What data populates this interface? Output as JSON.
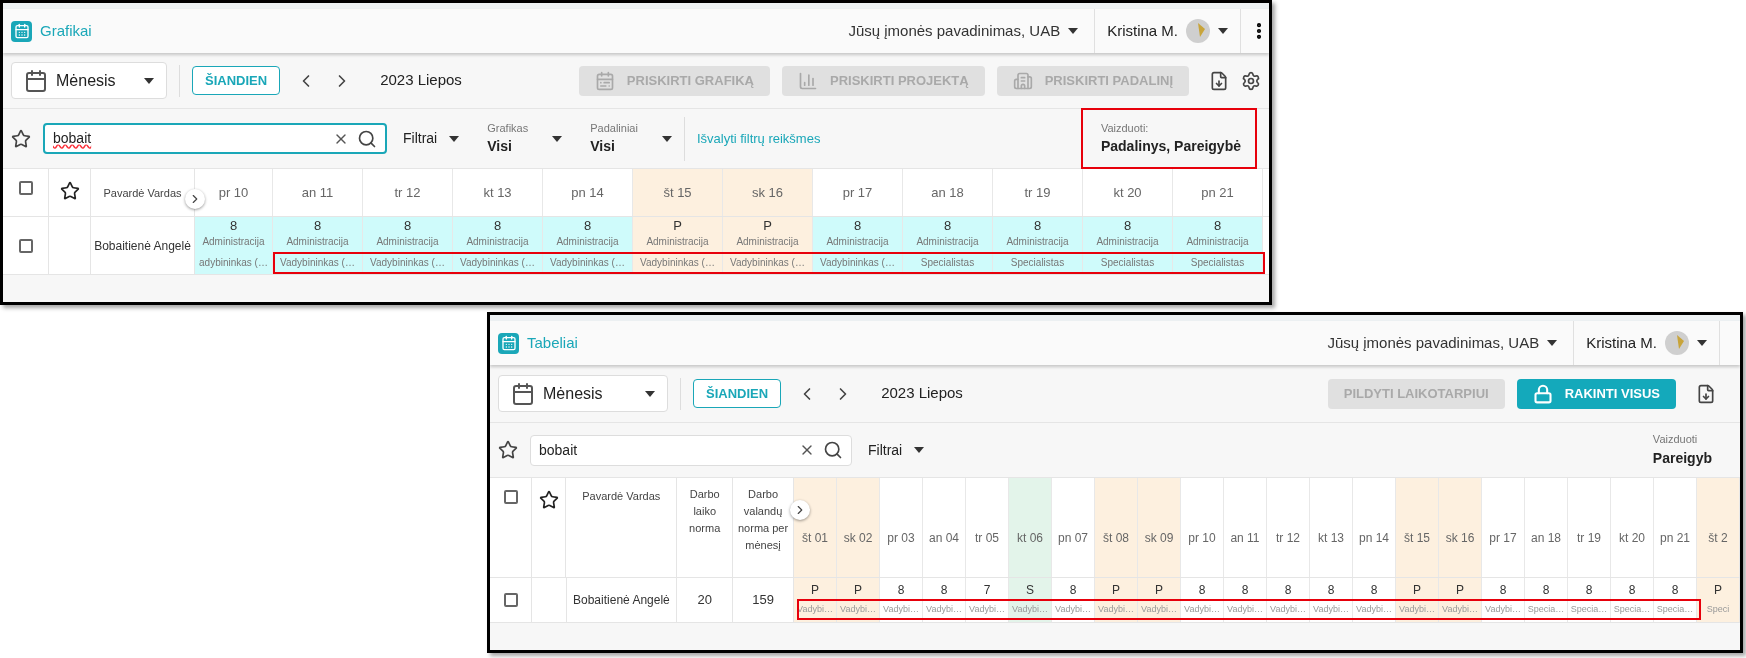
{
  "screens": [
    {
      "title": "Grafikai",
      "company": "Jūsų įmonės pavadinimas, UAB",
      "user": "Kristina M.",
      "more_menu": true,
      "view": "Mėnesis",
      "today_button": "ŠIANDIEN",
      "period": "2023 Liepos",
      "actions": [
        {
          "label": "PRISKIRTI GRAFIKĄ",
          "disabled": true
        },
        {
          "label": "PRISKIRTI PROJEKTĄ",
          "disabled": true
        },
        {
          "label": "PRISKIRTI PADALINĮ",
          "disabled": true
        }
      ],
      "settings": true,
      "search": {
        "value": "bobait",
        "focused": true,
        "spellcheck_error": true
      },
      "filters": "Filtrai",
      "dropdowns": [
        {
          "label": "Grafikas",
          "value": "Visi"
        },
        {
          "label": "Padaliniai",
          "value": "Visi"
        }
      ],
      "clear_link": "Išvalyti filtrų reikšmes",
      "display": {
        "label": "Vaizduoti:",
        "value": "Padalinys, Pareigybė",
        "highlighted": true
      },
      "table": {
        "header_checkbox": {
          "checked": false
        },
        "name_header": "Pavardė Vardas",
        "days": [
          {
            "label": "pr 10",
            "kind": "workday"
          },
          {
            "label": "an 11",
            "kind": "workday"
          },
          {
            "label": "tr 12",
            "kind": "workday"
          },
          {
            "label": "kt 13",
            "kind": "workday"
          },
          {
            "label": "pn 14",
            "kind": "workday"
          },
          {
            "label": "št 15",
            "kind": "weekend"
          },
          {
            "label": "sk 16",
            "kind": "weekend"
          },
          {
            "label": "pr 17",
            "kind": "workday"
          },
          {
            "label": "an 18",
            "kind": "workday"
          },
          {
            "label": "tr 19",
            "kind": "workday"
          },
          {
            "label": "kt 20",
            "kind": "workday"
          },
          {
            "label": "pn 21",
            "kind": "workday"
          }
        ],
        "rows": [
          {
            "checked": false,
            "name": "Bobaitienė Angelė",
            "highlighted": true,
            "cells": [
              {
                "value": "8",
                "unit": "Administracija",
                "position": "adybininkas (…"
              },
              {
                "value": "8",
                "unit": "Administracija",
                "position": "Vadybininkas (…"
              },
              {
                "value": "8",
                "unit": "Administracija",
                "position": "Vadybininkas (…"
              },
              {
                "value": "8",
                "unit": "Administracija",
                "position": "Vadybininkas (…"
              },
              {
                "value": "8",
                "unit": "Administracija",
                "position": "Vadybininkas (…"
              },
              {
                "value": "P",
                "unit": "Administracija",
                "position": "Vadybininkas (…"
              },
              {
                "value": "P",
                "unit": "Administracija",
                "position": "Vadybininkas (…"
              },
              {
                "value": "8",
                "unit": "Administracija",
                "position": "Vadybininkas (…"
              },
              {
                "value": "8",
                "unit": "Administracija",
                "position": "Specialistas"
              },
              {
                "value": "8",
                "unit": "Administracija",
                "position": "Specialistas"
              },
              {
                "value": "8",
                "unit": "Administracija",
                "position": "Specialistas"
              },
              {
                "value": "8",
                "unit": "Administracija",
                "position": "Specialistas"
              }
            ]
          }
        ]
      }
    },
    {
      "title": "Tabeliai",
      "company": "Jūsų įmonės pavadinimas, UAB",
      "user": "Kristina M.",
      "view": "Mėnesis",
      "today_button": "ŠIANDIEN",
      "period": "2023 Liepos",
      "actions": [
        {
          "label": "PILDYTI LAIKOTARPIUI",
          "disabled": true
        },
        {
          "label": "RAKINTI VISUS",
          "disabled": false
        }
      ],
      "search": {
        "value": "bobait",
        "focused": false
      },
      "filters": "Filtrai",
      "display": {
        "label": "Vaizduoti",
        "value": "Pareigyb",
        "highlighted": false
      },
      "table": {
        "header_checkbox": {
          "checked": false
        },
        "name_header": "Pavardė Vardas",
        "extra_columns": [
          "Darbo laiko norma",
          "Darbo valandų norma per mėnesį"
        ],
        "days": [
          {
            "label": "št 01",
            "kind": "weekend"
          },
          {
            "label": "sk 02",
            "kind": "weekend"
          },
          {
            "label": "pr 03",
            "kind": "workday"
          },
          {
            "label": "an 04",
            "kind": "workday"
          },
          {
            "label": "tr 05",
            "kind": "workday"
          },
          {
            "label": "kt 06",
            "kind": "holiday"
          },
          {
            "label": "pn 07",
            "kind": "workday"
          },
          {
            "label": "št 08",
            "kind": "weekend"
          },
          {
            "label": "sk 09",
            "kind": "weekend"
          },
          {
            "label": "pr 10",
            "kind": "workday"
          },
          {
            "label": "an 11",
            "kind": "workday"
          },
          {
            "label": "tr 12",
            "kind": "workday"
          },
          {
            "label": "kt 13",
            "kind": "workday"
          },
          {
            "label": "pn 14",
            "kind": "workday"
          },
          {
            "label": "št 15",
            "kind": "weekend"
          },
          {
            "label": "sk 16",
            "kind": "weekend"
          },
          {
            "label": "pr 17",
            "kind": "workday"
          },
          {
            "label": "an 18",
            "kind": "workday"
          },
          {
            "label": "tr 19",
            "kind": "workday"
          },
          {
            "label": "kt 20",
            "kind": "workday"
          },
          {
            "label": "pn 21",
            "kind": "workday"
          },
          {
            "label": "št 2",
            "kind": "weekend"
          }
        ],
        "rows": [
          {
            "checked": false,
            "name": "Bobaitienė Angelė",
            "extra": [
              "20",
              "159"
            ],
            "highlighted": true,
            "cells": [
              {
                "value": "P",
                "position": "Vadybi…"
              },
              {
                "value": "P",
                "position": "Vadybi…"
              },
              {
                "value": "8",
                "position": "Vadybi…"
              },
              {
                "value": "8",
                "position": "Vadybi…"
              },
              {
                "value": "7",
                "position": "Vadybi…"
              },
              {
                "value": "S",
                "position": "Vadybi…"
              },
              {
                "value": "8",
                "position": "Vadybi…"
              },
              {
                "value": "P",
                "position": "Vadybi…"
              },
              {
                "value": "P",
                "position": "Vadybi…"
              },
              {
                "value": "8",
                "position": "Vadybi…"
              },
              {
                "value": "8",
                "position": "Vadybi…"
              },
              {
                "value": "8",
                "position": "Vadybi…"
              },
              {
                "value": "8",
                "position": "Vadybi…"
              },
              {
                "value": "8",
                "position": "Vadybi…"
              },
              {
                "value": "P",
                "position": "Vadybi…"
              },
              {
                "value": "P",
                "position": "Vadybi…"
              },
              {
                "value": "8",
                "position": "Vadybi…"
              },
              {
                "value": "8",
                "position": "Specia…"
              },
              {
                "value": "8",
                "position": "Specia…"
              },
              {
                "value": "8",
                "position": "Specia…"
              },
              {
                "value": "8",
                "position": "Specia…"
              },
              {
                "value": "P",
                "position": "Speci"
              }
            ]
          }
        ]
      }
    }
  ]
}
